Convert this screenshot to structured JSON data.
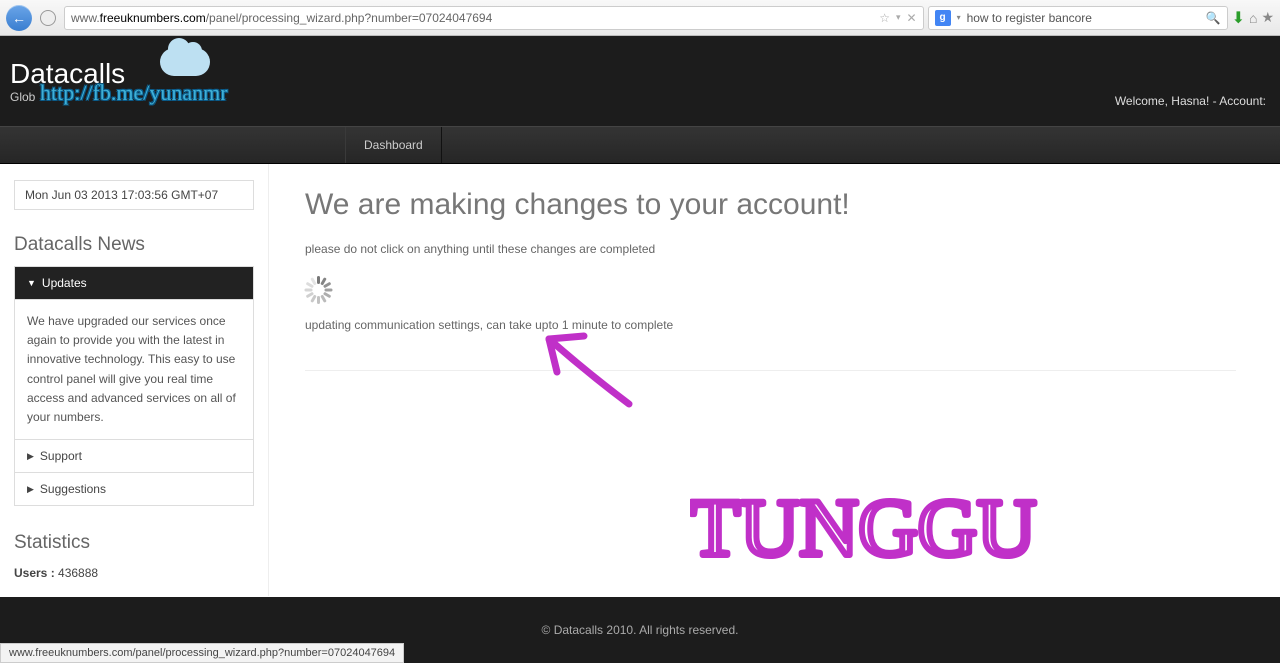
{
  "browser": {
    "url_prefix": "www.",
    "url_domain": "freeuknumbers.com",
    "url_path": "/panel/processing_wizard.php?number=07024047694",
    "search_value": "how to register bancore",
    "status_text": "www.freeuknumbers.com/panel/processing_wizard.php?number=07024047694"
  },
  "header": {
    "logo_main": "Datacalls",
    "logo_sub": "Glob",
    "welcome": "Welcome, Hasna! - Account:",
    "stamp_url": "http://fb.me/yunanmr"
  },
  "nav": {
    "dashboard": "Dashboard"
  },
  "sidebar": {
    "datetime": "Mon Jun 03 2013 17:03:56 GMT+07",
    "news_title": "Datacalls News",
    "updates_label": "Updates",
    "updates_body": "We have upgraded our services once again to provide you with the latest in innovative technology. This easy to use control panel will give you real time access and advanced services on all of your numbers.",
    "support_label": "Support",
    "suggestions_label": "Suggestions",
    "stats_title": "Statistics",
    "stats_users_label": "Users : ",
    "stats_users_value": "436888"
  },
  "main": {
    "title": "We are making changes to your account!",
    "subtitle": "please do not click on anything until these changes are completed",
    "update_msg": "updating communication settings, can take upto 1 minute to complete"
  },
  "footer": {
    "copyright": "© Datacalls 2010. All rights reserved."
  },
  "annotation": {
    "text": "TUNGGU"
  }
}
